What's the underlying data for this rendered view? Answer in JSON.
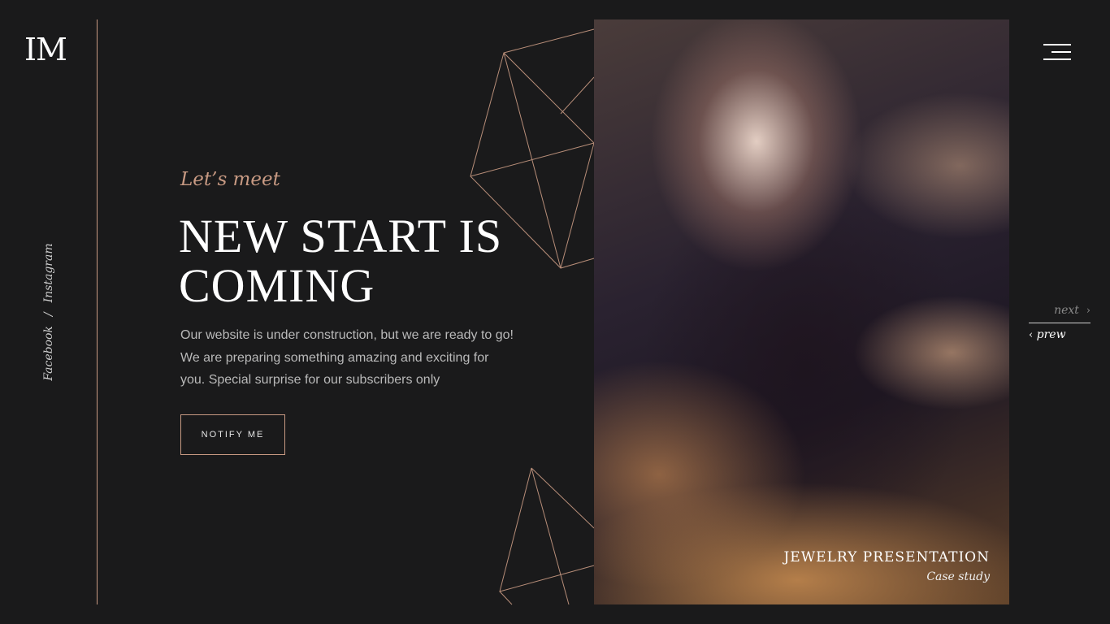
{
  "logo": {
    "text": "IM"
  },
  "social": {
    "facebook": "Facebook",
    "separator": "/",
    "instagram": "Instagram"
  },
  "hero": {
    "kicker": "Let’s meet",
    "headline": "NEW START IS COMING",
    "description": "Our website is under construction, but we are ready to go! We are preparing something amazing and exciting for you. Special surprise for our subscribers only",
    "button_label": "NOTIFY ME"
  },
  "feature": {
    "title": "JEWELRY PRESENTATION",
    "subtitle": "Case study"
  },
  "nav": {
    "next_label": "next",
    "next_arrow": "›",
    "prev_label": "prew",
    "prev_arrow": "‹"
  },
  "colors": {
    "background": "#1a1a1b",
    "accent": "#c89a83",
    "text": "#ffffff",
    "muted_text": "#b9b9b9"
  },
  "icons": [
    "menu-icon",
    "chevron-right-icon",
    "chevron-left-icon"
  ]
}
